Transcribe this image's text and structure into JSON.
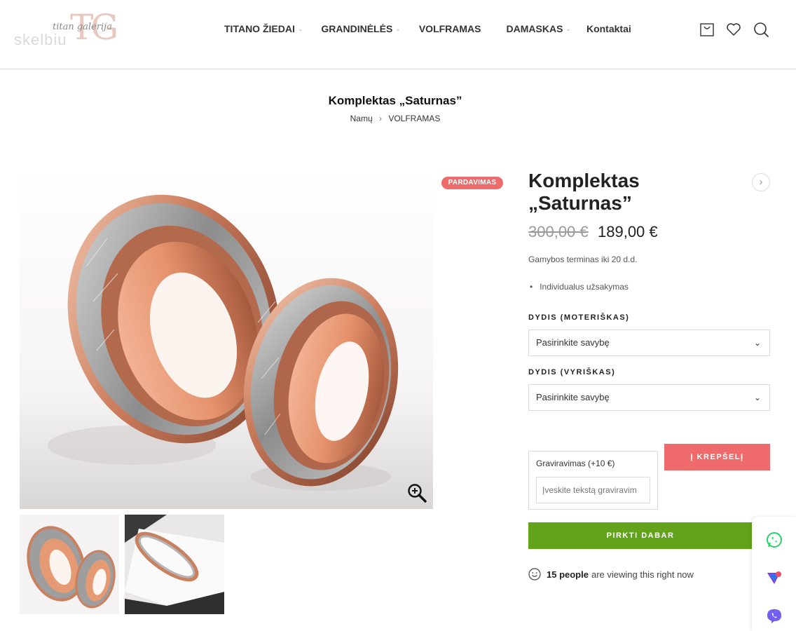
{
  "header": {
    "logo": {
      "monogram": "TG",
      "script": "titan galerija",
      "watermark": "skelbiu"
    },
    "nav": [
      {
        "label": "TITANO ŽIEDAI",
        "has_dropdown": true
      },
      {
        "label": "GRANDINĖLĖS",
        "has_dropdown": true
      },
      {
        "label": "VOLFRAMAS",
        "has_dropdown": false
      },
      {
        "label": "DAMASKAS",
        "has_dropdown": true
      },
      {
        "label": "Kontaktai",
        "has_dropdown": false
      }
    ],
    "icons": [
      "cart-icon",
      "heart-icon",
      "search-icon"
    ]
  },
  "page": {
    "title": "Komplektas „Saturnas”",
    "breadcrumb": {
      "home": "Namų",
      "separator": "›",
      "current": "VOLFRAMAS"
    }
  },
  "product": {
    "badge": "PARDAVIMAS",
    "title_line1": "Komplektas",
    "title_line2": "„Saturnas”",
    "old_price": "300,00 €",
    "new_price": "189,00 €",
    "production_term": "Gamybos terminas iki 20 d.d.",
    "features": [
      "Individualus užsakymas"
    ],
    "size_women": {
      "label": "DYDIS (MOTERIŠKAS)",
      "value": "Pasirinkite savybę"
    },
    "size_men": {
      "label": "DYDIS (VYRIŠKAS)",
      "value": "Pasirinkite savybę"
    },
    "engraving": {
      "label": "Graviravimas (+10 €)",
      "placeholder": "Įveskite tekstą graviravim"
    },
    "add_to_cart": "Į KREPŠELĮ",
    "buy_now": "PIRKTI DABAR",
    "viewing": {
      "count": "15 people",
      "text": "are viewing this right now"
    }
  },
  "floating": [
    "whatsapp-icon",
    "messenger-icon",
    "viber-icon"
  ],
  "colors": {
    "sale": "#ee6b6b",
    "cart_button": "#ef6b6b",
    "buy_button": "#62a31b",
    "whatsapp": "#25d366",
    "viber": "#7360f2"
  }
}
